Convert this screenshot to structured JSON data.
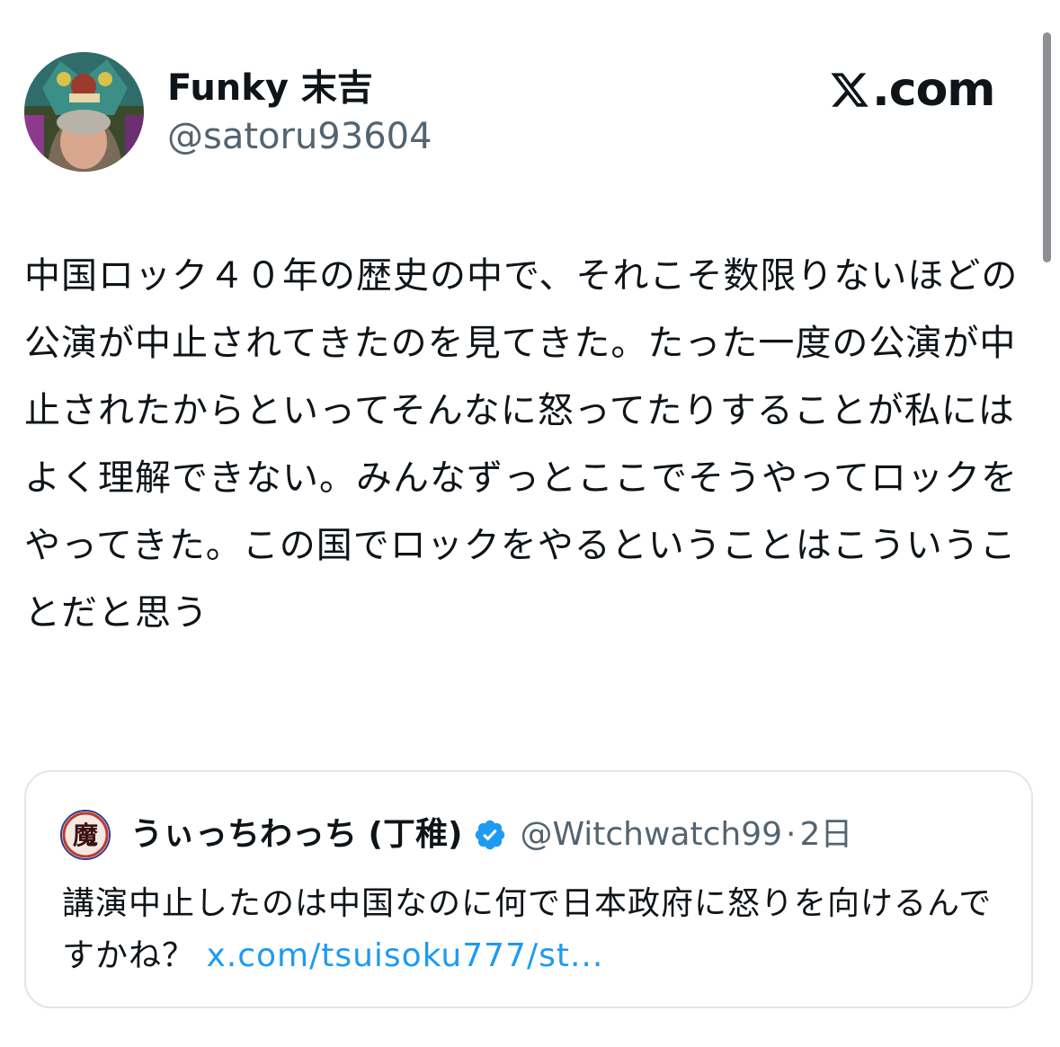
{
  "author": {
    "display_name": "Funky 末吉",
    "handle": "@satoru93604",
    "avatar_icon": "user-avatar-photo"
  },
  "brand": {
    "logo_icon": "x-logo-icon",
    "label": ".com"
  },
  "tweet": {
    "text": "中国ロック４０年の歴史の中で、それこそ数限りないほどの公演が中止されてきたのを見てきた。たった一度の公演が中止されたからといってそんなに怒ってたりすることが私にはよく理解できない。みんなずっとここでそうやってロックをやってきた。この国でロックをやるということはこういうことだと思う"
  },
  "quote": {
    "avatar_icon": "demon-kanji-avatar",
    "avatar_glyph": "魔",
    "display_name": "うぃっちわっち (丁稚)",
    "verified_icon": "verified-badge-icon",
    "handle": "@Witchwatch99",
    "separator": "·",
    "time": "2日",
    "text": "講演中止したのは中国なのに何で日本政府に怒りを向けるんですかね？ ",
    "link": "x.com/tsuisoku777/st..."
  },
  "colors": {
    "text_primary": "#0f1419",
    "text_secondary": "#536471",
    "link": "#1d9bf0",
    "verified": "#1d9bf0",
    "card_border": "#e1e6ea"
  }
}
